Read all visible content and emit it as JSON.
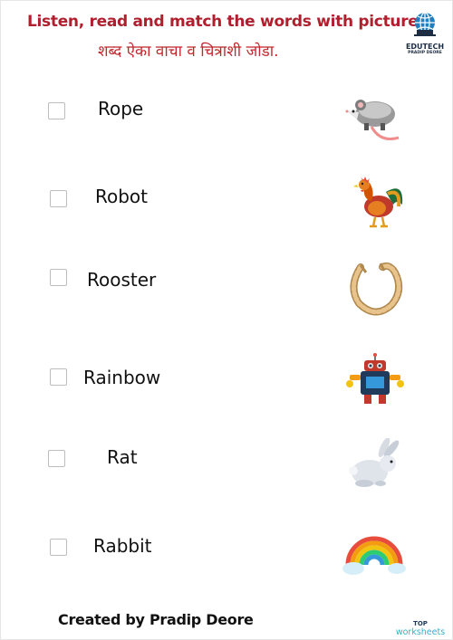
{
  "header": {
    "title_en": "Listen, read and match the words with pictures.",
    "title_mr": "शब्द ऐका वाचा व चित्राशी जोडा.",
    "logo_label": "EDUTECH",
    "logo_sub": "PRADIP DEORE"
  },
  "words": [
    {
      "label": "Rope"
    },
    {
      "label": "Robot"
    },
    {
      "label": "Rooster"
    },
    {
      "label": "Rainbow"
    },
    {
      "label": "Rat"
    },
    {
      "label": "Rabbit"
    }
  ],
  "pictures": [
    {
      "icon": "rat-icon"
    },
    {
      "icon": "rooster-icon"
    },
    {
      "icon": "rope-icon"
    },
    {
      "icon": "robot-icon"
    },
    {
      "icon": "rabbit-icon"
    },
    {
      "icon": "rainbow-icon"
    }
  ],
  "footer": {
    "credit": "Created by Pradip Deore",
    "brand_top": "TOP",
    "brand_bottom": "worksheets"
  }
}
